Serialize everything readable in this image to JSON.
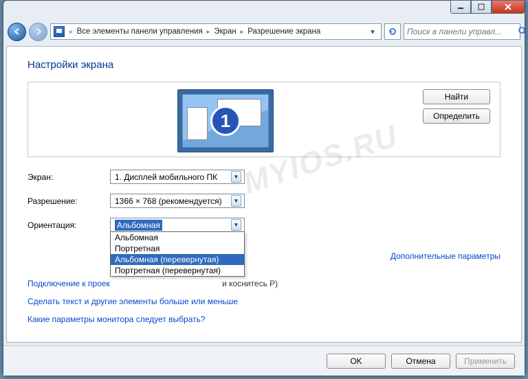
{
  "titlebar": {
    "min": "–",
    "max": "☐",
    "close": "×"
  },
  "address": {
    "prefix": "«",
    "crumb1": "Все элементы панели управления",
    "crumb2": "Экран",
    "crumb3": "Разрешение экрана"
  },
  "search": {
    "placeholder": "Поиск в панели управл..."
  },
  "page": {
    "title": "Настройки экрана",
    "monitor_number": "1",
    "watermark": "MYIOS.RU"
  },
  "preview_buttons": {
    "find": "Найти",
    "identify": "Определить"
  },
  "labels": {
    "screen": "Экран:",
    "resolution": "Разрешение:",
    "orientation": "Ориентация:"
  },
  "combos": {
    "screen_value": "1. Дисплей мобильного ПК",
    "resolution_value": "1366 × 768 (рекомендуется)",
    "orientation_value": "Альбомная",
    "orientation_options": [
      "Альбомная",
      "Портретная",
      "Альбомная (перевернутая)",
      "Портретная (перевернутая)"
    ]
  },
  "links": {
    "advanced": "Дополнительные параметры",
    "projector": "Подключение к проек",
    "projector_hint": "и коснитесь P)",
    "text_size": "Сделать текст и другие элементы больше или меньше",
    "which_settings": "Какие параметры монитора следует выбрать?"
  },
  "footer": {
    "ok": "OK",
    "cancel": "Отмена",
    "apply": "Применить"
  }
}
